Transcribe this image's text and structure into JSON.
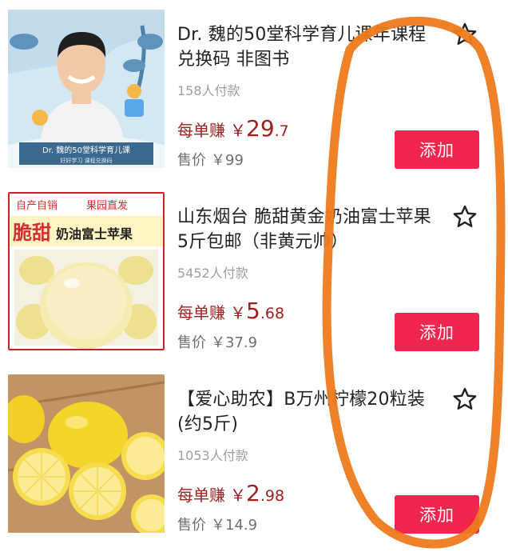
{
  "products": [
    {
      "title": "Dr. 魏的50堂科学育儿课年课程兑换码 非图书",
      "buyers": "158人付款",
      "earn_label": "每单赚",
      "earn_currency": "￥",
      "earn_int": "29",
      "earn_dec": ".7",
      "price_label": "售价",
      "price_value": "￥99",
      "add_label": "添加",
      "image_text": [
        "Dr. 魏的50堂科学育儿课",
        "好好学习 课程兑换码"
      ]
    },
    {
      "title": "山东烟台 脆甜黄金奶油富士苹果 5斤包邮（非黄元帅）",
      "buyers": "5452人付款",
      "earn_label": "每单赚",
      "earn_currency": "￥",
      "earn_int": "5",
      "earn_dec": ".68",
      "price_label": "售价",
      "price_value": "￥37.9",
      "add_label": "添加",
      "image_text": [
        "自产自销",
        "果园直发",
        "脆甜",
        "奶油富士苹果"
      ]
    },
    {
      "title": "【爱心助农】B万州柠檬20粒装(约5斤)",
      "buyers": "1053人付款",
      "earn_label": "每单赚",
      "earn_currency": "￥",
      "earn_int": "2",
      "earn_dec": ".98",
      "price_label": "售价",
      "price_value": "￥14.9",
      "add_label": "添加",
      "image_text": []
    }
  ],
  "icons": [
    "star-outline-icon"
  ],
  "colors": {
    "accent": "#f0264f",
    "earn": "#9f1f1f",
    "muted": "#9e9e9e",
    "annotation": "#ee7a1e"
  }
}
